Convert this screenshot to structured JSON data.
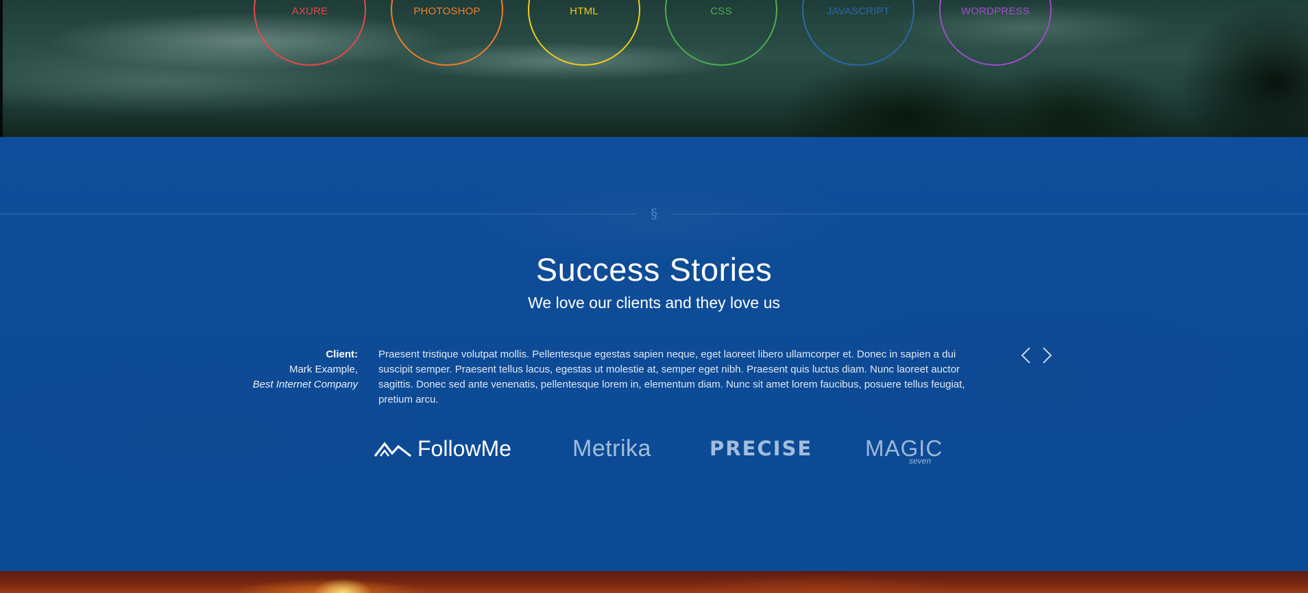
{
  "skills": [
    {
      "label": "AXURE",
      "color": "#e8484b"
    },
    {
      "label": "PHOTOSHOP",
      "color": "#f07d2c"
    },
    {
      "label": "HTML",
      "color": "#f1cd1a"
    },
    {
      "label": "CSS",
      "color": "#4caf4f"
    },
    {
      "label": "JAVASCRIPT",
      "color": "#2b68a8"
    },
    {
      "label": "WORDPRESS",
      "color": "#9b4fc7"
    }
  ],
  "section": {
    "divider_symbol": "§",
    "title": "Success Stories",
    "subtitle": "We love our clients and they love us"
  },
  "testimonial": {
    "client_heading": "Client:",
    "client_name": "Mark Example,",
    "client_company": "Best Internet Company",
    "text": "Praesent tristique volutpat mollis. Pellentesque egestas sapien neque, eget laoreet libero ullamcorper et. Donec in sapien a dui suscipit semper. Praesent tellus lacus, egestas ut molestie at, semper eget nibh. Praesent quis luctus diam. Nunc laoreet auctor sagittis. Donec sed ante venenatis, pellentesque lorem in, elementum diam. Nunc sit amet lorem faucibus, posuere tellus feugiat, pretium arcu."
  },
  "navigation": {
    "prev_icon": "chevron-left-icon",
    "next_icon": "chevron-right-icon"
  },
  "logos": {
    "followme": {
      "text": "FollowMe",
      "icon": "mountain-icon"
    },
    "metrika": {
      "text": "Metrika"
    },
    "precise": {
      "text": "PRECISE"
    },
    "magic": {
      "text": "MAGIC",
      "sub": "seven"
    }
  },
  "colors": {
    "stories_background": "#0d4b96",
    "text_white": "#ffffff"
  }
}
